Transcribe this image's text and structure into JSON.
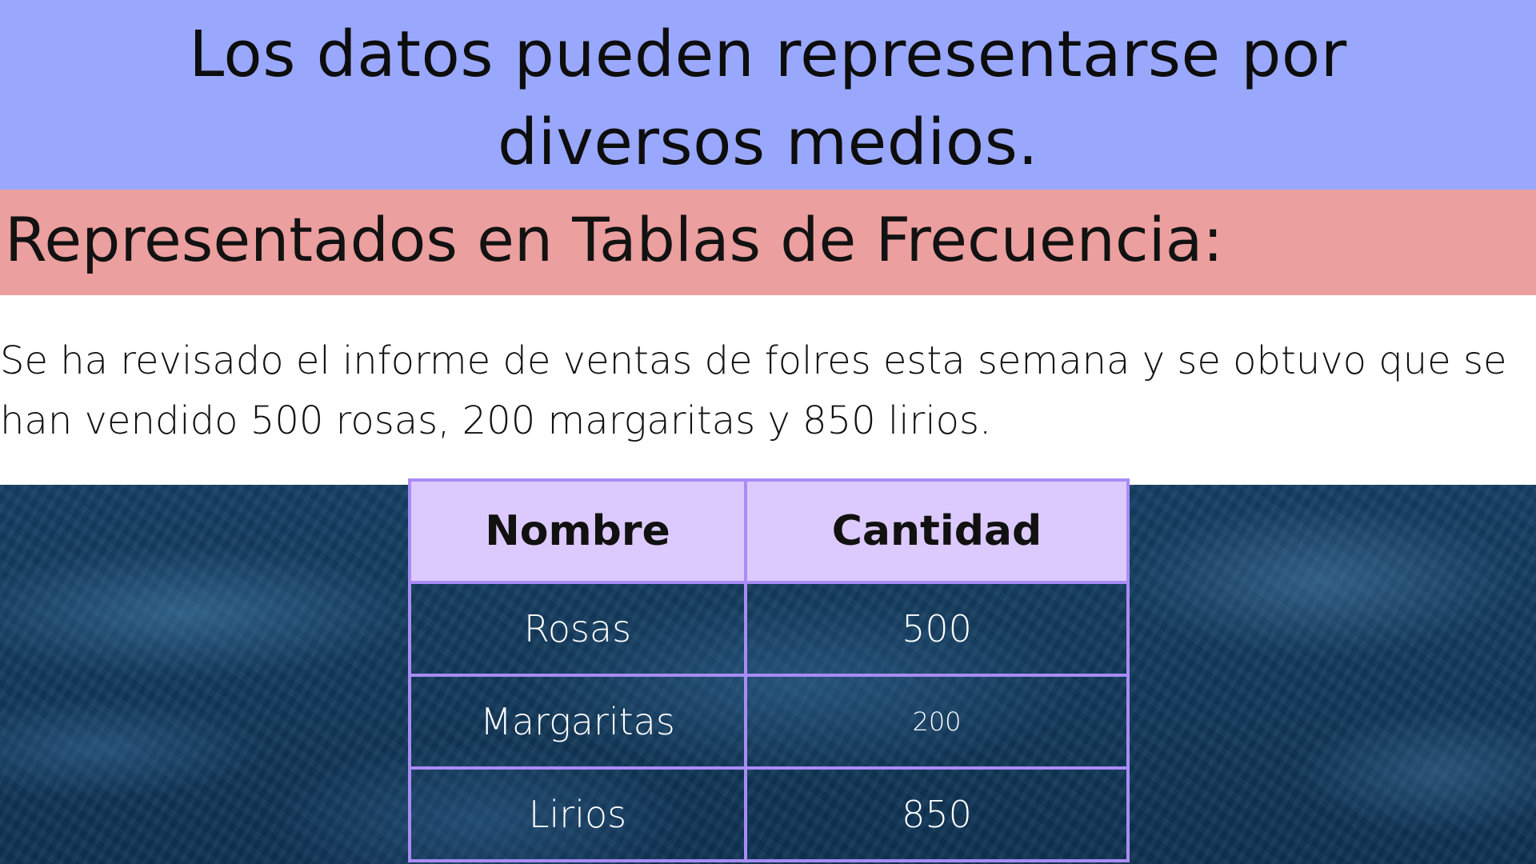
{
  "header": {
    "title": "Los datos pueden representarse por diversos medios."
  },
  "section": {
    "subtitle": "Representados en Tablas de Frecuencia:"
  },
  "description": {
    "line1": "Se ha revisado el informe de ventas de folres esta semana y se obtuvo que se",
    "line2": "han vendido 500 rosas, 200 margaritas y 850 lirios."
  },
  "table": {
    "headers": [
      "Nombre",
      "Cantidad"
    ],
    "rows": [
      {
        "name": "Rosas",
        "quantity": "500"
      },
      {
        "name": "Margaritas",
        "quantity": "200"
      },
      {
        "name": "Lirios",
        "quantity": "850"
      }
    ]
  },
  "colors": {
    "title_band": "#99a8fd",
    "subtitle_band": "#eb9f9e",
    "table_border": "#a98cf5",
    "table_header": "#dccafe",
    "background_texture": "#153e63"
  }
}
